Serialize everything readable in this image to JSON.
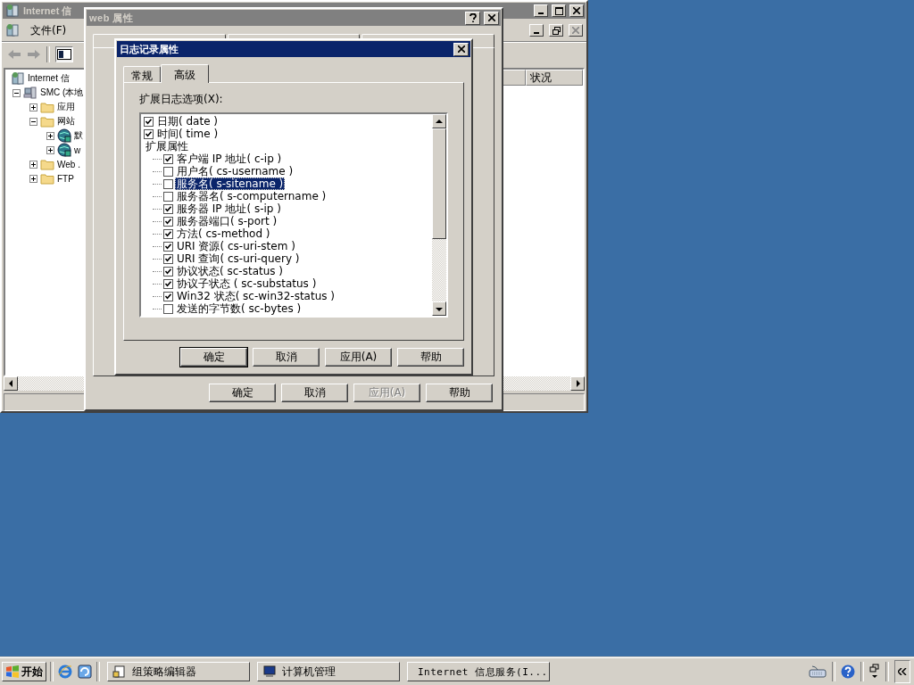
{
  "iis_window": {
    "title": "Internet 信",
    "menu": [
      "文件(F)"
    ],
    "tree": [
      {
        "label": "Internet 信",
        "kind": "iis",
        "children": [
          {
            "label": "SMC (本地",
            "kind": "server",
            "expanded": true,
            "children": [
              {
                "label": "应用",
                "kind": "folder",
                "expanded": false
              },
              {
                "label": "网站",
                "kind": "folder",
                "expanded": true,
                "children": [
                  {
                    "label": "默",
                    "kind": "globe",
                    "expanded": false
                  },
                  {
                    "label": "w",
                    "kind": "globe",
                    "expanded": false
                  }
                ]
              },
              {
                "label": "Web .",
                "kind": "folder",
                "expanded": false
              },
              {
                "label": "FTP",
                "kind": "folder",
                "expanded": false
              }
            ]
          }
        ]
      }
    ],
    "columns": [
      "状况"
    ]
  },
  "web_dialog": {
    "title": "web 属性",
    "buttons": [
      {
        "label": "确定",
        "default": false,
        "disabled": false
      },
      {
        "label": "取消",
        "default": false,
        "disabled": false
      },
      {
        "label": "应用(A)",
        "default": false,
        "disabled": true
      },
      {
        "label": "帮助",
        "default": false,
        "disabled": false
      }
    ]
  },
  "log_dialog": {
    "title": "日志记录属性",
    "tabs": [
      {
        "label": "常规",
        "selected": false
      },
      {
        "label": "高级",
        "selected": true
      }
    ],
    "options_label": "扩展日志选项(X):",
    "options": [
      {
        "kind": "option",
        "label": "日期( date )",
        "checked": true,
        "selected": false
      },
      {
        "kind": "option",
        "label": "时间( time )",
        "checked": true,
        "selected": false
      },
      {
        "kind": "group",
        "label": "扩展属性",
        "selected": false,
        "children": [
          {
            "label": "客户端 IP 地址( c-ip )",
            "checked": true,
            "selected": false
          },
          {
            "label": "用户名( cs-username )",
            "checked": false,
            "selected": false
          },
          {
            "label": "服务名( s-sitename )",
            "checked": false,
            "selected": true
          },
          {
            "label": "服务器名( s-computername )",
            "checked": false,
            "selected": false
          },
          {
            "label": "服务器 IP 地址( s-ip )",
            "checked": true,
            "selected": false
          },
          {
            "label": "服务器端口( s-port )",
            "checked": true,
            "selected": false
          },
          {
            "label": "方法( cs-method )",
            "checked": true,
            "selected": false
          },
          {
            "label": "URI 资源( cs-uri-stem )",
            "checked": true,
            "selected": false
          },
          {
            "label": "URI 查询( cs-uri-query )",
            "checked": true,
            "selected": false
          },
          {
            "label": "协议状态( sc-status )",
            "checked": true,
            "selected": false
          },
          {
            "label": "协议子状态 ( sc-substatus )",
            "checked": true,
            "selected": false
          },
          {
            "label": "Win32 状态( sc-win32-status )",
            "checked": true,
            "selected": false
          },
          {
            "label": "发送的字节数( sc-bytes )",
            "checked": false,
            "selected": false
          }
        ]
      }
    ],
    "buttons": [
      {
        "label": "确定",
        "default": true,
        "disabled": false
      },
      {
        "label": "取消",
        "default": false,
        "disabled": false
      },
      {
        "label": "应用(A)",
        "default": false,
        "disabled": false
      },
      {
        "label": "帮助",
        "default": false,
        "disabled": false
      }
    ]
  },
  "taskbar": {
    "start": "开始",
    "tasks": [
      {
        "label": "组策略编辑器",
        "kind": "policy",
        "selected": false
      },
      {
        "label": "计算机管理",
        "kind": "computer",
        "selected": false
      },
      {
        "label": "Internet 信息服务(I...",
        "kind": "iis",
        "selected": false
      }
    ]
  }
}
